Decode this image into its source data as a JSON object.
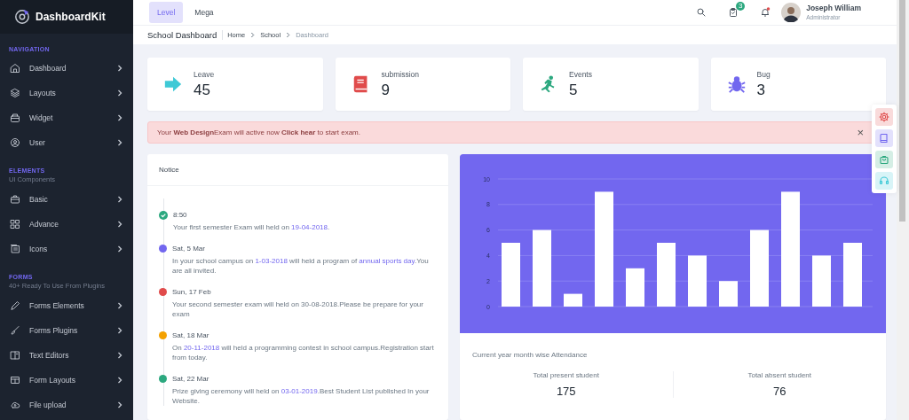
{
  "brand": "DashboardKit",
  "sidebar": {
    "sections": [
      {
        "title": "NAVIGATION",
        "items": [
          {
            "label": "Dashboard"
          },
          {
            "label": "Layouts"
          },
          {
            "label": "Widget"
          },
          {
            "label": "User"
          }
        ]
      },
      {
        "title": "ELEMENTS",
        "subtitle": "UI Components",
        "items": [
          {
            "label": "Basic"
          },
          {
            "label": "Advance"
          },
          {
            "label": "Icons"
          }
        ]
      },
      {
        "title": "FORMS",
        "subtitle": "40+ Ready To Use From Plugins",
        "items": [
          {
            "label": "Forms Elements"
          },
          {
            "label": "Forms Plugins"
          },
          {
            "label": "Text Editors"
          },
          {
            "label": "Form Layouts"
          },
          {
            "label": "File upload"
          }
        ]
      }
    ]
  },
  "topbar": {
    "tabs": [
      {
        "label": "Level",
        "selected": true
      },
      {
        "label": "Mega",
        "selected": false
      }
    ],
    "notification_badge": "3",
    "user": {
      "name": "Joseph William",
      "role": "Administrator"
    }
  },
  "breadcrumb": {
    "title": "School Dashboard",
    "items": [
      "Home",
      "School",
      "Dashboard"
    ]
  },
  "stats": [
    {
      "label": "Leave",
      "value": "45",
      "color": "#3ec9d6"
    },
    {
      "label": "submission",
      "value": "9",
      "color": "#e04b4b"
    },
    {
      "label": "Events",
      "value": "5",
      "color": "#2ca87f"
    },
    {
      "label": "Bug",
      "value": "3",
      "color": "#7267ef"
    }
  ],
  "alert": {
    "text": "Your **Web Design**Exam will active now **Click hear** to start exam.",
    "close": "×"
  },
  "notice": {
    "title": "Notice",
    "items": [
      {
        "kind": "check",
        "color": "#2ca87f",
        "time": "8:50",
        "parts": [
          {
            "text": "Your first semester Exam will held on ",
            "link": false
          },
          {
            "text": "19-04-2018",
            "link": true
          },
          {
            "text": ".",
            "link": false
          }
        ]
      },
      {
        "kind": "dot",
        "color": "#7267ef",
        "time": "Sat, 5 Mar",
        "parts": [
          {
            "text": "In your school campus on ",
            "link": false
          },
          {
            "text": "1-03-2018",
            "link": true
          },
          {
            "text": " will held a program of ",
            "link": false
          },
          {
            "text": "annual sports day",
            "link": true
          },
          {
            "text": ".You are all invited.",
            "link": false
          }
        ]
      },
      {
        "kind": "dot",
        "color": "#e04b4b",
        "time": "Sun, 17 Feb",
        "parts": [
          {
            "text": "Your second semester exam will held on 30-08-2018.Please be prepare for your exam",
            "link": false
          }
        ]
      },
      {
        "kind": "dot",
        "color": "#f4a100",
        "time": "Sat, 18 Mar",
        "parts": [
          {
            "text": "On ",
            "link": false
          },
          {
            "text": "20-11-2018",
            "link": true
          },
          {
            "text": " will held a programming contest in school campus.Registration start from today.",
            "link": false
          }
        ]
      },
      {
        "kind": "dot",
        "color": "#2ca87f",
        "time": "Sat, 22 Mar",
        "parts": [
          {
            "text": "Prize giving ceremony will held on ",
            "link": false
          },
          {
            "text": "03-01-2019",
            "link": true
          },
          {
            "text": ".Best Student List published In your Website.",
            "link": false
          }
        ]
      }
    ]
  },
  "attendance": {
    "chart_data": {
      "type": "bar",
      "values": [
        5,
        6,
        1,
        9,
        3,
        5,
        4,
        2,
        6,
        9,
        4,
        5
      ],
      "ylim": [
        0,
        10
      ],
      "yticks": [
        0,
        2,
        4,
        6,
        8,
        10
      ],
      "grid": true
    },
    "caption": "Current year month wise Attendance",
    "totals": [
      {
        "label": "Total present student",
        "value": "175"
      },
      {
        "label": "Total absent student",
        "value": "76"
      }
    ]
  },
  "quick_tools": [
    {
      "color": "#e04b4b"
    },
    {
      "color": "#7267ef"
    },
    {
      "color": "#2ca87f"
    },
    {
      "color": "#3ec9d6"
    }
  ]
}
